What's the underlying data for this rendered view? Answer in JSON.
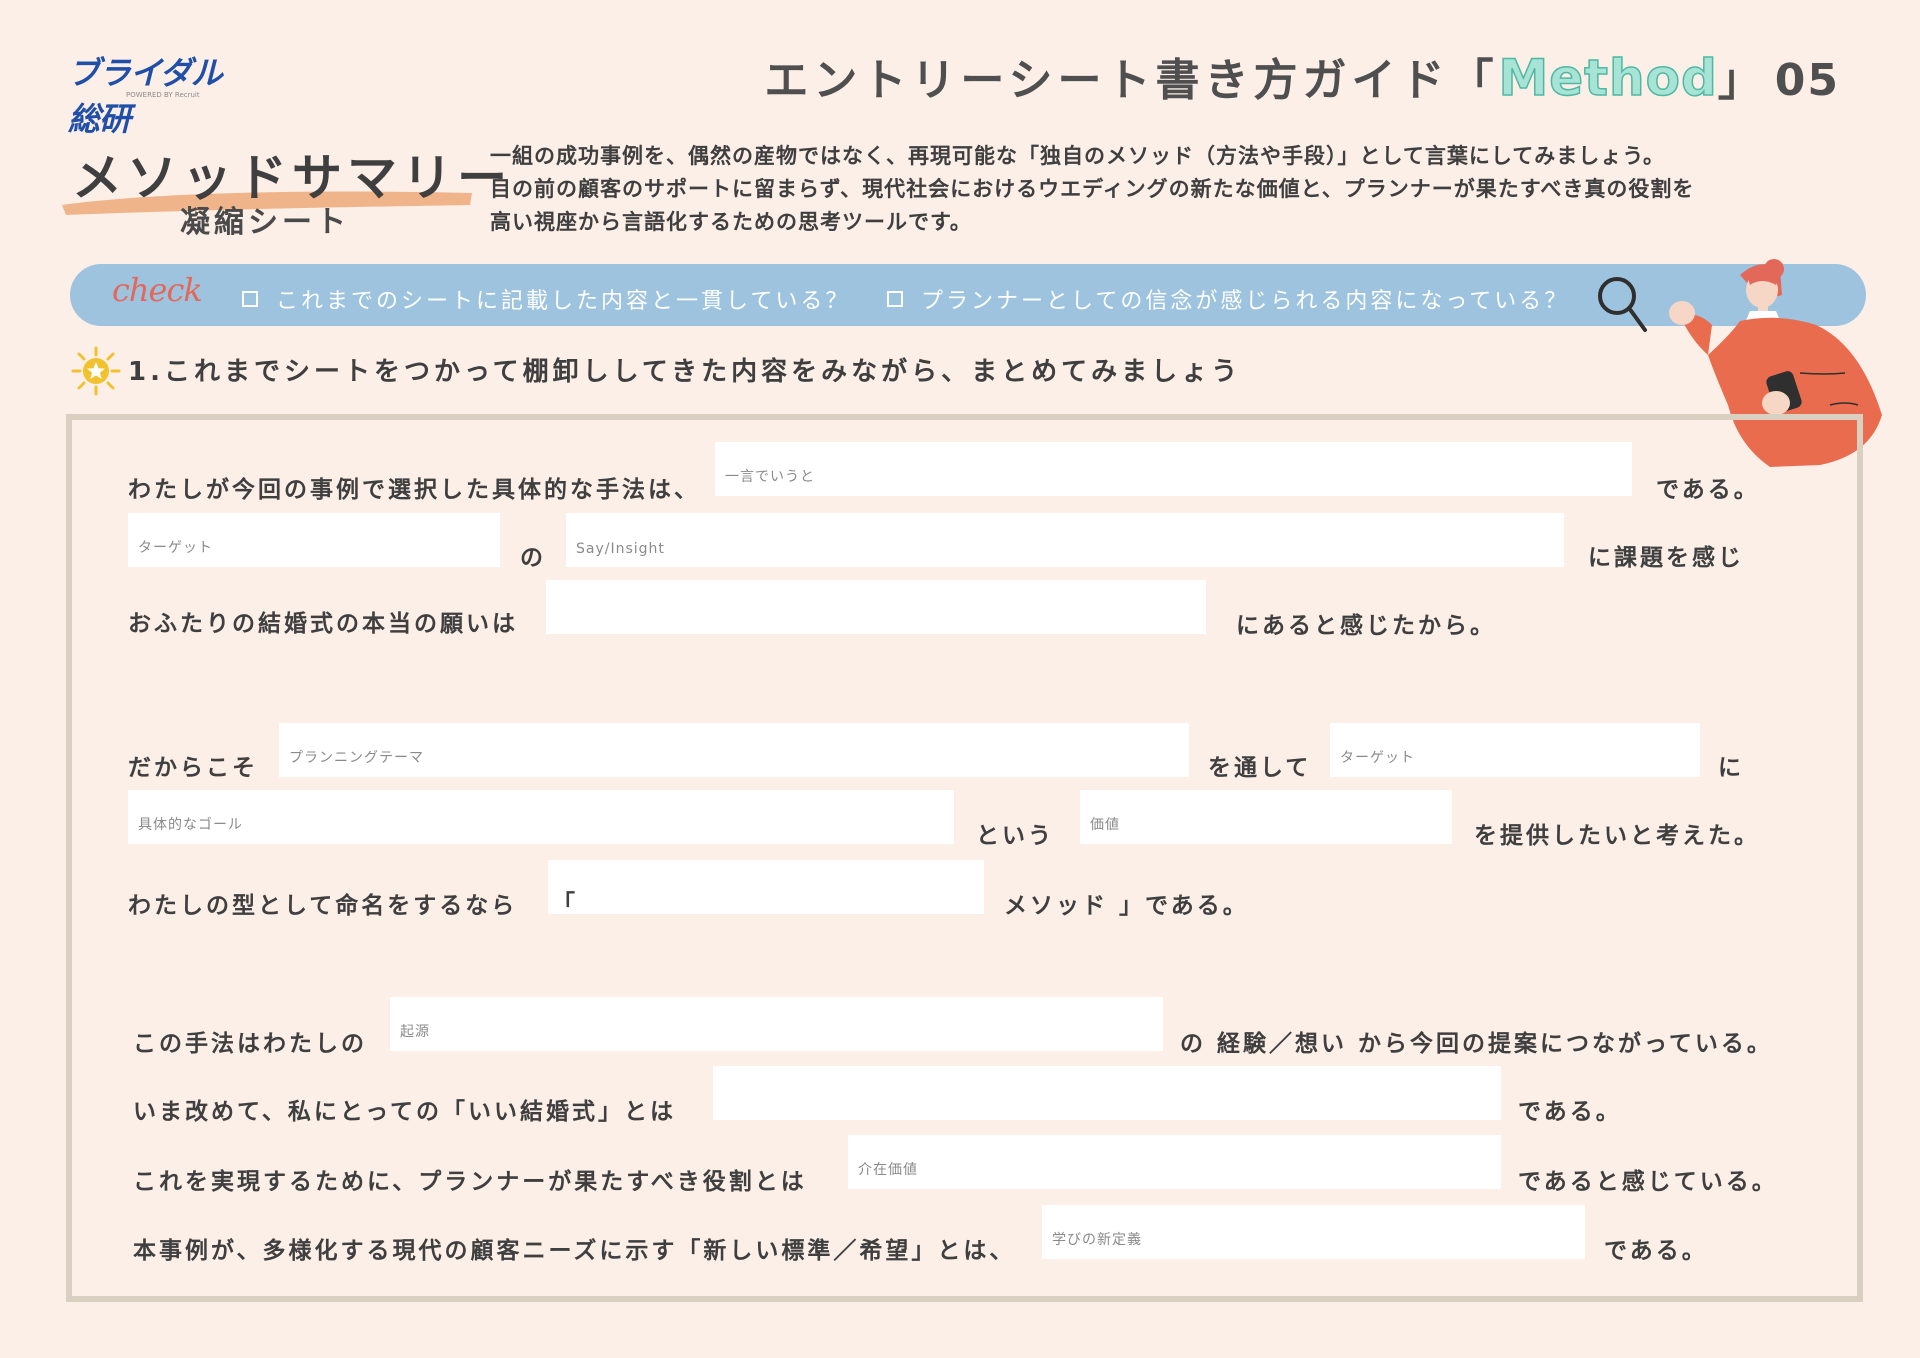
{
  "logo": {
    "text": "ブライダル総研",
    "sub": "POWERED BY Recruit"
  },
  "header": {
    "prefix": "エントリーシート書き方ガイド「",
    "method": "Method",
    "suffix": "」",
    "number": "05"
  },
  "summary": {
    "title": "メソッドサマリー",
    "subtitle": "凝縮シート",
    "intro": [
      "一組の成功事例を、偶然の産物ではなく、再現可能な「独自のメソッド（方法や手段）」として言葉にしてみましょう。",
      "目の前の顧客のサポートに留まらず、現代社会におけるウエディングの新たな価値と、プランナーが果たすべき真の役割を",
      "高い視座から言語化するための思考ツールです。"
    ]
  },
  "check": {
    "label": "check",
    "items": [
      "これまでのシートに記載した内容と一貫している？",
      "プランナーとしての信念が感じられる内容になっている？"
    ]
  },
  "section1": {
    "heading": "1.これまでシートをつかって棚卸ししてきた内容をみながら、まとめてみましょう"
  },
  "form": {
    "l1_a": "わたしが今回の事例で選択した具体的な手法は、",
    "l1_ph": "一言でいうと",
    "l1_b": "である。",
    "l2_ph1": "ターゲット",
    "l2_a": "の",
    "l2_ph2": "Say/Insight",
    "l2_b": "に課題を感じ",
    "l3_a": "おふたりの結婚式の本当の願いは",
    "l3_b": "にあると感じたから。",
    "l4_a": "だからこそ",
    "l4_ph1": "プランニングテーマ",
    "l4_b": "を通して",
    "l4_ph2": "ターゲット",
    "l4_c": "に",
    "l5_ph1": "具体的なゴール",
    "l5_a": "という",
    "l5_ph2": "価値",
    "l5_b": "を提供したいと考えた。",
    "l6_a": "わたしの型として命名をするなら",
    "l6_q": "「",
    "l6_b": "メソッド 」である。",
    "l7_a": "この手法はわたしの",
    "l7_ph": "起源",
    "l7_b": "の 経験／想い から今回の提案につながっている。",
    "l8_a": "いま改めて、私にとっての「いい結婚式」とは",
    "l8_b": "である。",
    "l9_a": "これを実現するために、プランナーが果たすべき役割とは",
    "l9_ph": "介在価値",
    "l9_b": "であると感じている。",
    "l10_a": "本事例が、多様化する現代の顧客ニーズに示す「新しい標準／希望」とは、",
    "l10_ph": "学びの新定義",
    "l10_b": "である。"
  }
}
